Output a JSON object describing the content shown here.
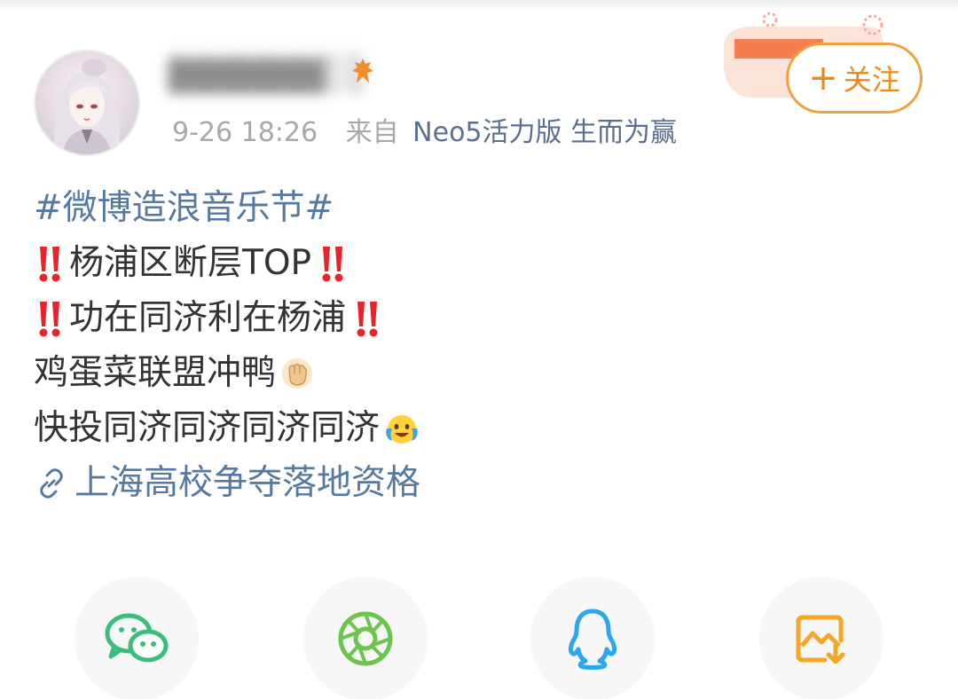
{
  "post": {
    "username": "▇▇▇▇▇▇",
    "time": "9-26 18:26",
    "from_label": "来自",
    "device": "Neo5活力版 生而为赢",
    "follow_label": "关注",
    "follow_plus": "+"
  },
  "content": {
    "topic": "#微博造浪音乐节#",
    "line1": "杨浦区断层TOP",
    "line2": "功在同济利在杨浦",
    "line3": "鸡蛋菜联盟冲鸭",
    "line4": "快投同济同济同济同济",
    "link_text": "上海高校争夺落地资格"
  },
  "share": {
    "items": [
      "wechat-icon",
      "moments-icon",
      "qq-icon",
      "save-image-icon"
    ]
  },
  "colors": {
    "accent_orange": "#ee8a1a",
    "link_blue": "#56799f",
    "wechat_green": "#3dbd7d",
    "moments_green": "#6cc34d",
    "qq_blue": "#2aa7ef",
    "save_orange": "#f5a623",
    "bang_red": "#e8242a"
  }
}
